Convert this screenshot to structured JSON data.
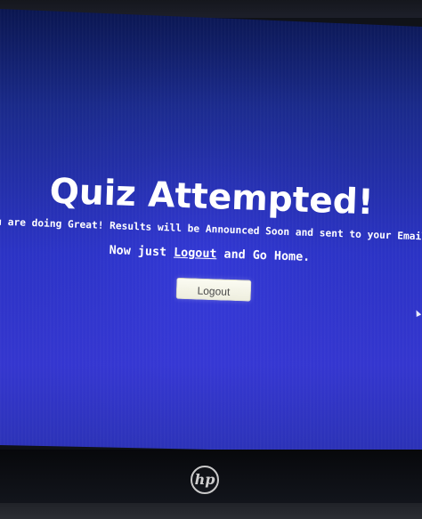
{
  "screen": {
    "title": "Quiz Attempted!",
    "message_line": "ou are doing Great! Results will be Announced Soon and sent to your Email.",
    "action_prefix": "Now just ",
    "logout_link": "Logout",
    "action_suffix": " and Go Home.",
    "logout_button": "Logout"
  },
  "device": {
    "brand_logo_text": "hp"
  },
  "colors": {
    "screen_blue": "#2b33c5",
    "text": "#ffffff",
    "button_bg": "#fbfbf2"
  }
}
